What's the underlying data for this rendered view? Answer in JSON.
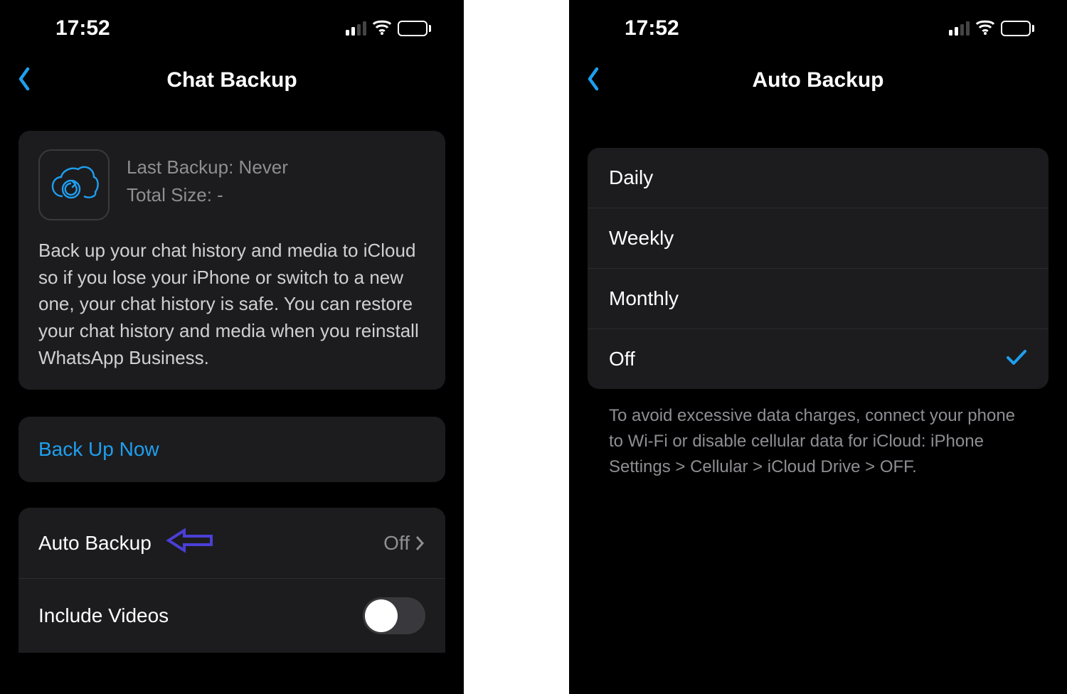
{
  "left": {
    "status": {
      "time": "17:52"
    },
    "nav": {
      "title": "Chat Backup"
    },
    "info": {
      "last_backup": "Last Backup: Never",
      "total_size": "Total Size: -",
      "description": "Back up your chat history and media to iCloud so if you lose your iPhone or switch to a new one, your chat history is safe. You can restore your chat history and media when you reinstall WhatsApp Business."
    },
    "backup_now": "Back Up Now",
    "settings": {
      "auto_backup_label": "Auto Backup",
      "auto_backup_value": "Off",
      "include_videos_label": "Include Videos"
    }
  },
  "right": {
    "status": {
      "time": "17:52"
    },
    "nav": {
      "title": "Auto Backup"
    },
    "options": [
      {
        "label": "Daily",
        "selected": false
      },
      {
        "label": "Weekly",
        "selected": false
      },
      {
        "label": "Monthly",
        "selected": false
      },
      {
        "label": "Off",
        "selected": true
      }
    ],
    "footer": "To avoid excessive data charges, connect your phone to Wi-Fi or disable cellular data for iCloud: iPhone Settings > Cellular > iCloud Drive > OFF."
  }
}
